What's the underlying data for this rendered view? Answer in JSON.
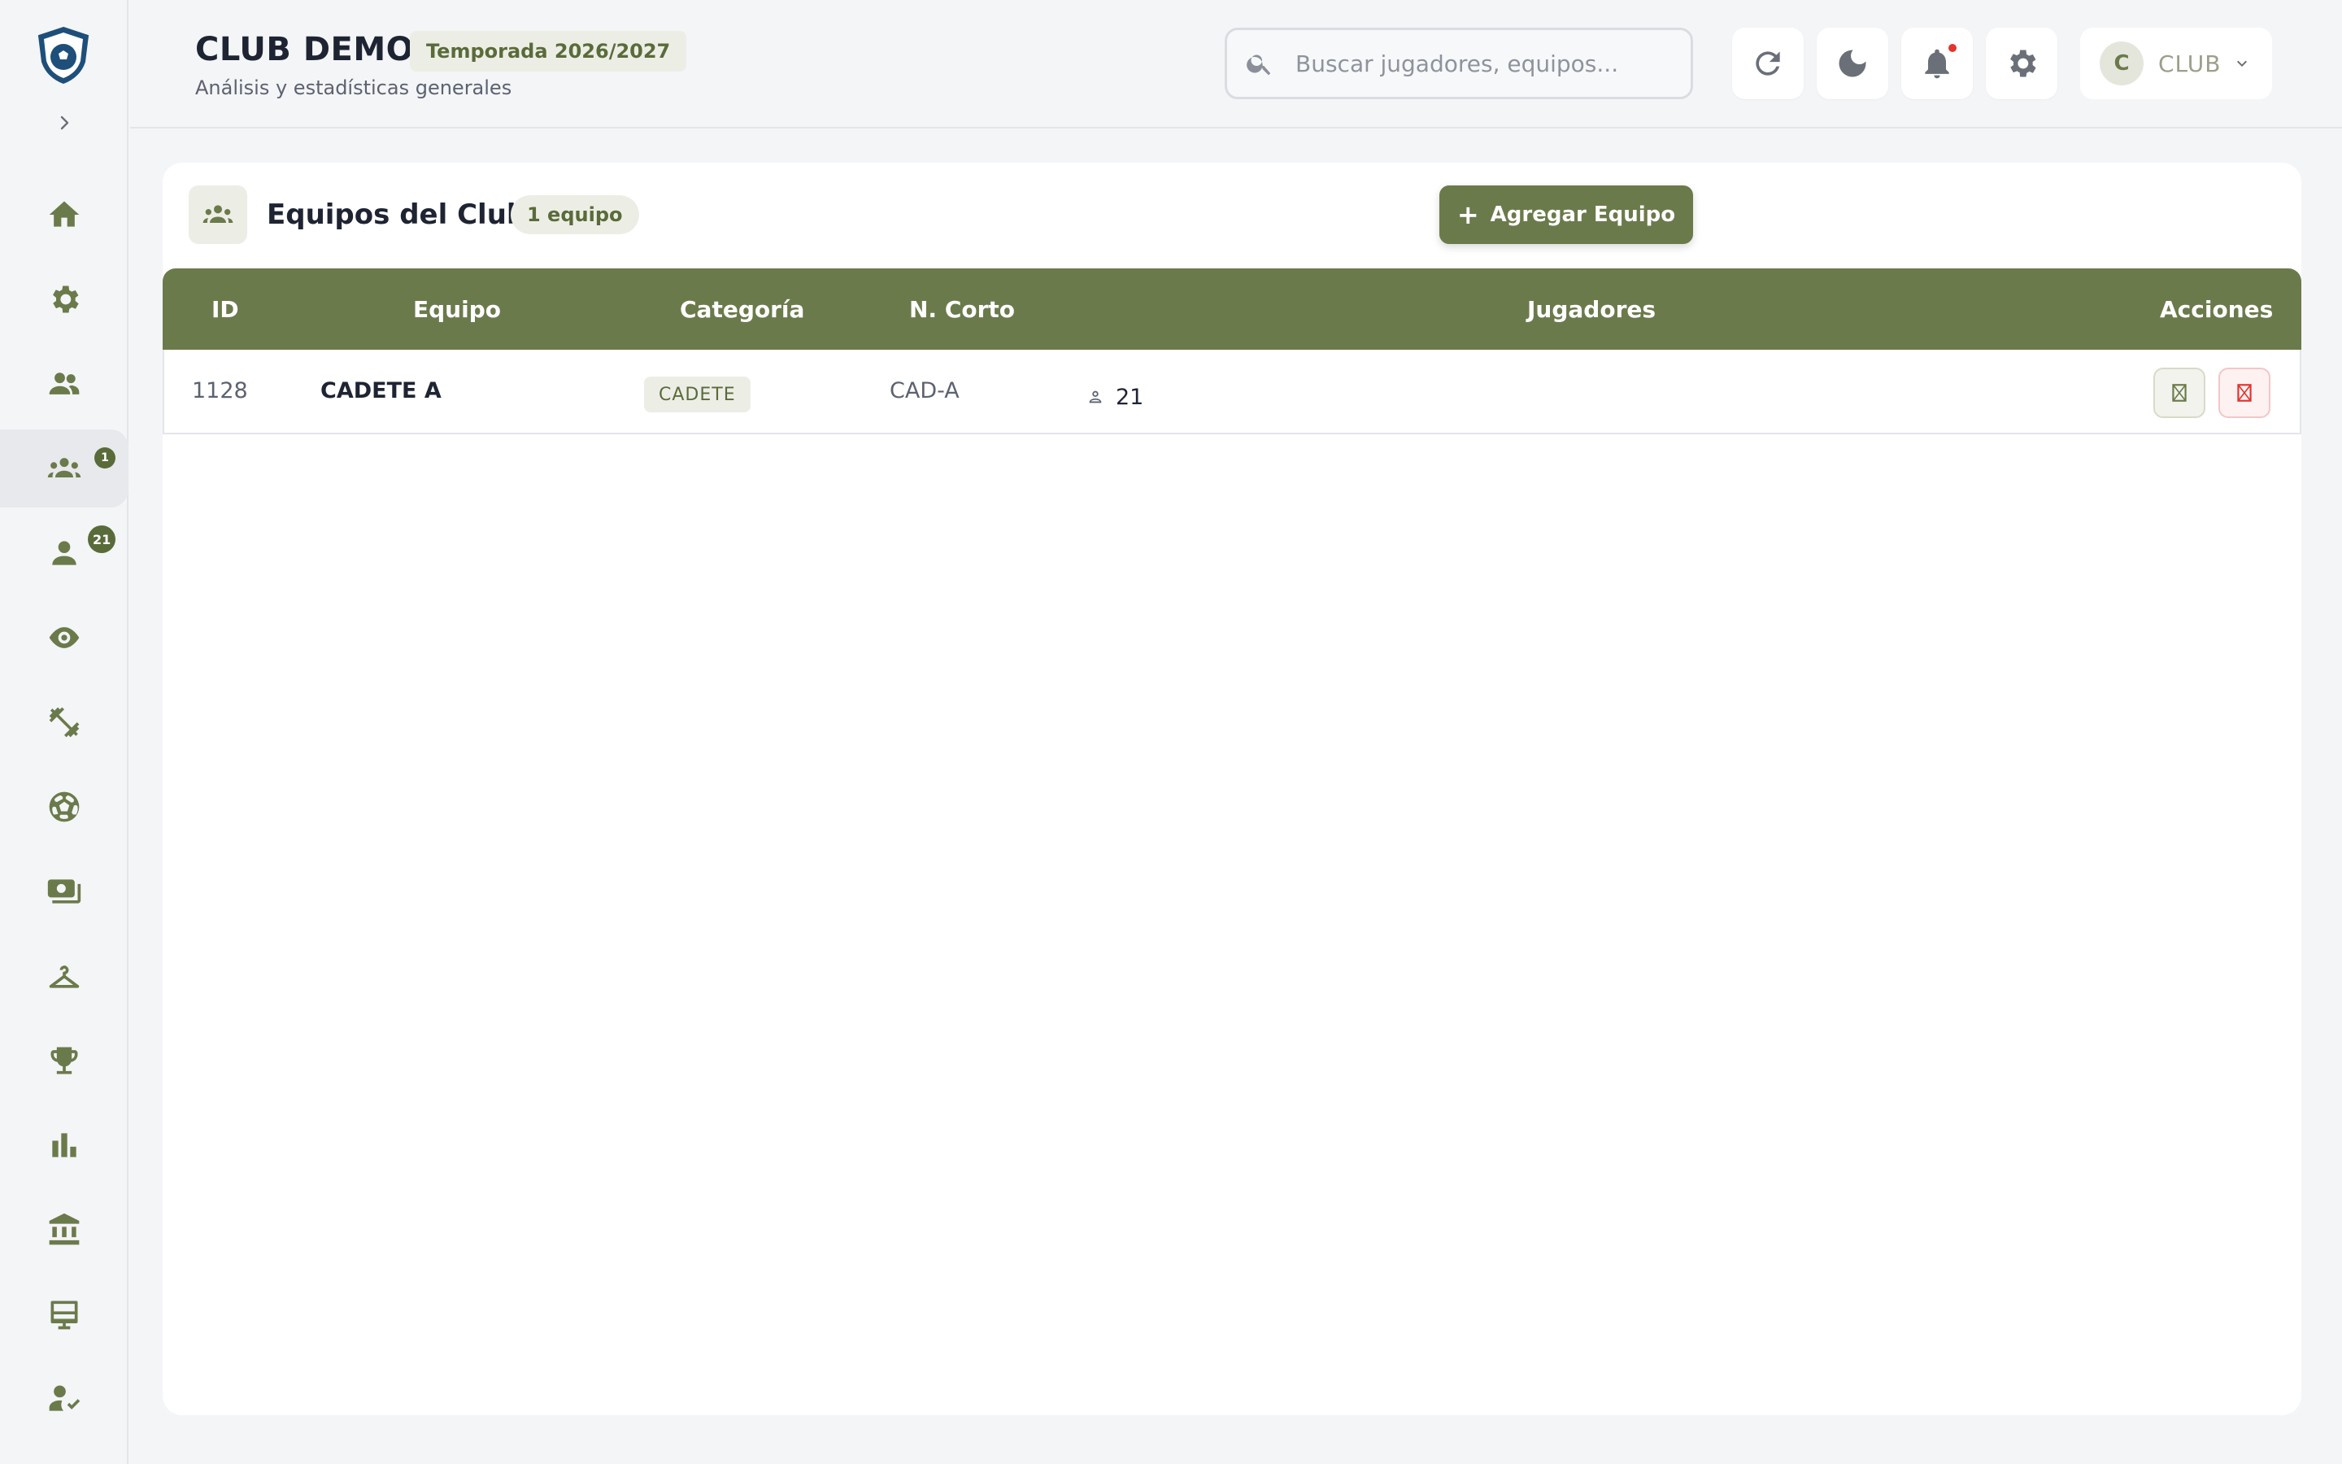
{
  "header": {
    "club_name": "CLUB DEMO",
    "season": "Temporada 2026/2027",
    "subtitle": "Análisis y estadísticas generales",
    "search_placeholder": "Buscar jugadores, equipos...",
    "user_initial": "C",
    "user_name": "CLUB"
  },
  "sidebar": {
    "items": [
      {
        "icon": "home-icon"
      },
      {
        "icon": "gear-icon"
      },
      {
        "icon": "people-icon"
      },
      {
        "icon": "teams-icon",
        "badge": "1",
        "active": true
      },
      {
        "icon": "person-icon",
        "badge": "21"
      },
      {
        "icon": "eye-icon"
      },
      {
        "icon": "fitness-icon"
      },
      {
        "icon": "soccer-ball-icon"
      },
      {
        "icon": "cash-icon"
      },
      {
        "icon": "hanger-icon"
      },
      {
        "icon": "trophy-icon"
      },
      {
        "icon": "bar-chart-icon"
      },
      {
        "icon": "bank-icon"
      },
      {
        "icon": "kiosk-icon"
      },
      {
        "icon": "person-check-icon"
      }
    ]
  },
  "main": {
    "title": "Equipos del Club",
    "count_badge": "1 equipo",
    "add_button": "Agregar Equipo",
    "columns": [
      "ID",
      "Equipo",
      "Categoría",
      "N. Corto",
      "Jugadores",
      "Acciones"
    ],
    "rows": [
      {
        "id": "1128",
        "equipo": "CADETE A",
        "categoria": "CADETE",
        "corto": "CAD-A",
        "jugadores": "21"
      }
    ]
  },
  "colors": {
    "accent": "#6b7a4b",
    "badge_bg": "#eceee6",
    "danger": "#e3342f"
  }
}
